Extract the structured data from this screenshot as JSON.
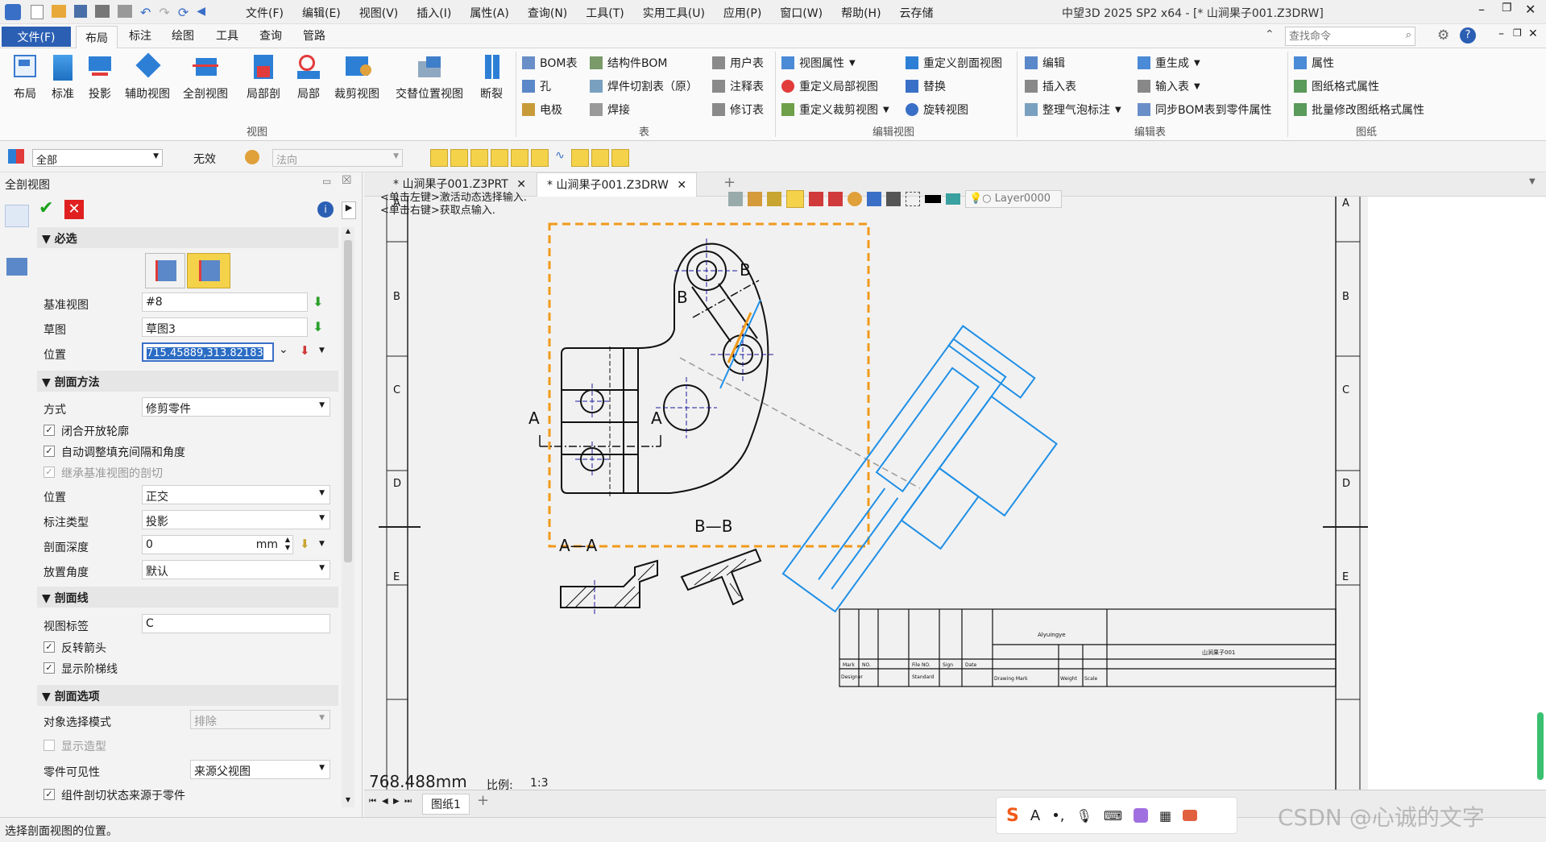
{
  "app": {
    "window_title": "中望3D 2025 SP2 x64 - [* 山涧果子001.Z3DRW]",
    "menu": [
      "文件(F)",
      "编辑(E)",
      "视图(V)",
      "插入(I)",
      "属性(A)",
      "查询(N)",
      "工具(T)",
      "实用工具(U)",
      "应用(P)",
      "窗口(W)",
      "帮助(H)",
      "云存储"
    ]
  },
  "ribbon_tabs": [
    "文件(F)",
    "布局",
    "标注",
    "绘图",
    "工具",
    "查询",
    "管路"
  ],
  "search": {
    "placeholder": "查找命令"
  },
  "ribbon": {
    "view_group": {
      "label": "视图",
      "buttons": [
        "布局",
        "标准",
        "投影",
        "辅助视图",
        "全剖视图",
        "局部剖",
        "局部",
        "裁剪视图",
        "交替位置视图",
        "断裂"
      ]
    },
    "table_group": {
      "label": "表",
      "items": [
        "BOM表",
        "结构件BOM",
        "用户表",
        "孔",
        "焊件切割表（原）",
        "注释表",
        "电极",
        "焊接",
        "修订表"
      ]
    },
    "editview_group": {
      "label": "编辑视图",
      "items": [
        "视图属性",
        "重定义剖面视图",
        "重定义局部视图",
        "替换",
        "重定义裁剪视图",
        "旋转视图"
      ]
    },
    "edittable_group": {
      "label": "编辑表",
      "items": [
        "编辑",
        "重生成",
        "插入表",
        "输入表",
        "整理气泡标注",
        "同步BOM表到零件属性"
      ]
    },
    "sheet_group": {
      "label": "图纸",
      "items": [
        "属性",
        "图纸格式属性",
        "批量修改图纸格式属性"
      ]
    }
  },
  "filterbar": {
    "filter": "全部",
    "invalid": "无效",
    "normal": "法向"
  },
  "panel": {
    "title": "全剖视图",
    "required": "必选",
    "base_view_label": "基准视图",
    "base_view_value": "#8",
    "sketch_label": "草图",
    "sketch_value": "草图3",
    "position_label": "位置",
    "position_value": "715.45889,313.82183",
    "section_method": "剖面方法",
    "mode_label": "方式",
    "mode_value": "修剪零件",
    "cb_close": "闭合开放轮廓",
    "cb_auto": "自动调整填充间隔和角度",
    "cb_inherit": "继承基准视图的剖切",
    "pos2_label": "位置",
    "pos2_value": "正交",
    "annot_label": "标注类型",
    "annot_value": "投影",
    "depth_label": "剖面深度",
    "depth_value": "0",
    "depth_unit": "mm",
    "angle_label": "放置角度",
    "angle_value": "默认",
    "section_line": "剖面线",
    "view_label_label": "视图标签",
    "view_label_value": "C",
    "cb_reverse": "反转箭头",
    "cb_step": "显示阶梯线",
    "section_options": "剖面选项",
    "obj_mode_label": "对象选择模式",
    "obj_mode_value": "排除",
    "cb_show_shape": "显示造型",
    "part_vis_label": "零件可见性",
    "part_vis_value": "来源父视图",
    "cb_component": "组件剖切状态来源于零件"
  },
  "doc_tabs": [
    "* 山涧果子001.Z3PRT",
    "* 山涧果子001.Z3DRW"
  ],
  "canvas": {
    "hint1": "<单击左键>激活动态选择输入.",
    "hint2": "<单击右键>获取点输入.",
    "layer": "Layer0000",
    "label_AA": "A—A",
    "label_BB": "B—B",
    "letter_A": "A",
    "letter_B": "B",
    "coord": "768.488mm",
    "scale_label": "比例:",
    "scale_value": "1:3",
    "sheet": "图纸1",
    "border_letters": [
      "A",
      "B",
      "C",
      "D",
      "E"
    ],
    "title_block": {
      "company": "Alyuingye",
      "name": "山涧果子001",
      "mark": "Mark",
      "no": "NO.",
      "file_no": "File NO.",
      "sign": "Sign",
      "date": "Date",
      "designer": "Designer",
      "standard": "Standard",
      "drawing_mark": "Drawing Mark",
      "weight": "Weight",
      "scale": "Scale"
    }
  },
  "status": {
    "text": "选择剖面视图的位置。",
    "watermark": "CSDN @心诚的文字"
  },
  "colors": {
    "accent": "#2b6cc4",
    "selection": "#f09a1a",
    "blue_view": "#1e8fe6"
  }
}
